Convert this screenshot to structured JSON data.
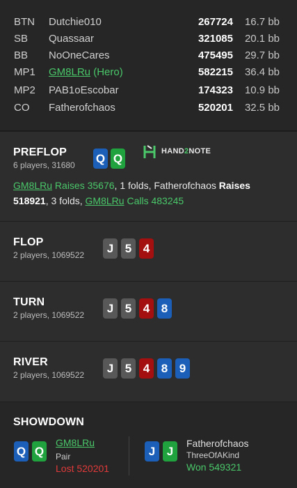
{
  "players": [
    {
      "pos": "BTN",
      "name": "Dutchie010",
      "stack": "267724",
      "bb": "16.7 bb"
    },
    {
      "pos": "SB",
      "name": "Quassaar",
      "stack": "321085",
      "bb": "20.1 bb"
    },
    {
      "pos": "BB",
      "name": "NoOneCares",
      "stack": "475495",
      "bb": "29.7 bb"
    },
    {
      "pos": "MP1",
      "name": "GM8LRu",
      "hero_tag": " (Hero)",
      "stack": "582215",
      "bb": "36.4 bb"
    },
    {
      "pos": "MP2",
      "name": "PAB1oEscobar",
      "stack": "174323",
      "bb": "10.9 bb"
    },
    {
      "pos": "CO",
      "name": "Fatherofchaos",
      "stack": "520201",
      "bb": "32.5 bb"
    }
  ],
  "preflop": {
    "title": "PREFLOP",
    "sub": "6 players, 31680",
    "hero_cards": [
      "Q",
      "Q"
    ],
    "logo_text_a": "HAND",
    "logo_text_b": "2",
    "logo_text_c": "NOTE",
    "actions": {
      "p1": "GM8LRu",
      "a1": "Raises 35676",
      "t1": ", 1 folds, ",
      "p2": "Fatherofchaos",
      "a2": "Raises",
      "v2": "518921",
      "t2": ", 3 folds, ",
      "p3": "GM8LRu",
      "a3": "Calls 483245"
    }
  },
  "flop": {
    "title": "FLOP",
    "sub": "2 players, 1069522",
    "cards": [
      "J",
      "5",
      "4"
    ]
  },
  "turn": {
    "title": "TURN",
    "sub": "2 players, 1069522",
    "cards": [
      "J",
      "5",
      "4",
      "8"
    ]
  },
  "river": {
    "title": "RIVER",
    "sub": "2 players, 1069522",
    "cards": [
      "J",
      "5",
      "4",
      "8",
      "9"
    ]
  },
  "showdown": {
    "title": "SHOWDOWN",
    "left": {
      "cards": [
        "Q",
        "Q"
      ],
      "name": "GM8LRu",
      "hand": "Pair",
      "result": "Lost 520201"
    },
    "right": {
      "cards": [
        "J",
        "J"
      ],
      "name": "Fatherofchaos",
      "hand": "ThreeOfAKind",
      "result": "Won 549321"
    }
  },
  "colors": {
    "spade": "#585858",
    "heart": "#a40f0f",
    "diamond": "#1b5fb8",
    "club": "#20a33e",
    "accent": "#4ac86a",
    "loss": "#e23a3a"
  }
}
